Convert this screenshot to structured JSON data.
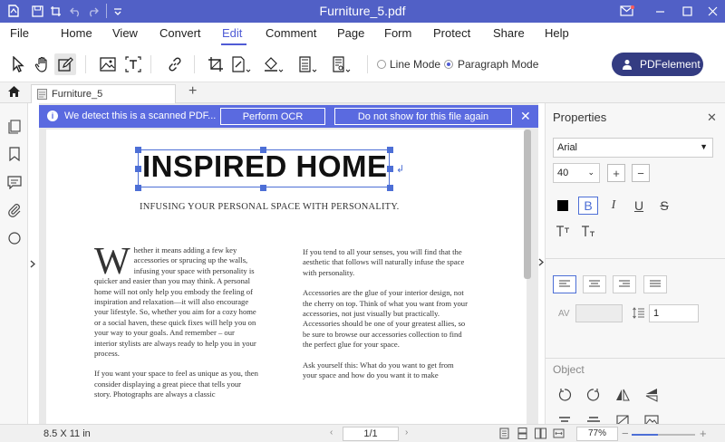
{
  "window": {
    "title": "Furniture_5.pdf",
    "icons": [
      "logo-icon",
      "save-icon",
      "crop-icon",
      "undo-icon",
      "redo-icon",
      "quick-access-icon",
      "mail-icon",
      "minimize-icon",
      "maximize-icon",
      "close-icon"
    ]
  },
  "menu": {
    "items": [
      "File",
      "Home",
      "View",
      "Convert",
      "Edit",
      "Comment",
      "Page",
      "Form",
      "Protect",
      "Share",
      "Help"
    ],
    "active": "Edit"
  },
  "toolbar": {
    "line_mode": "Line Mode",
    "paragraph_mode": "Paragraph Mode",
    "selected_mode": "Paragraph Mode",
    "pdfelement_button": "PDFelement"
  },
  "tabs": {
    "doc_tab": "Furniture_5",
    "add_tab": "+"
  },
  "ocr_bar": {
    "message": "We detect this is a scanned PDF...",
    "perform_ocr": "Perform OCR",
    "do_not_show": "Do not show for this file again",
    "close": "✕"
  },
  "document": {
    "heading": "INSPIRED HOME",
    "subtitle": "INFUSING YOUR PERSONAL SPACE WITH PERSONALITY.",
    "dropcap": "W",
    "col1_p1": "hether it means adding a few key accessories or sprucing up the walls, infusing your space with personality is quicker and easier than you may think. A personal home will not only help you embody the feeling of inspiration and relaxation—it will also encourage your lifestyle. So, whether you aim for a cozy home or a social haven, these quick fixes will help you on your way to your goals. And remember – our interior stylists are always ready to help you in your process.",
    "col1_p2": "If you want your space to feel as unique as you, then consider displaying a great piece that tells your story. Photographs are always a classic",
    "col2_p1": "If you tend to all your senses, you will find that the aesthetic that follows will naturally infuse the space with personality.",
    "col2_p2": "Accessories are the glue of your interior design, not the cherry on top. Think of what you want from your accessories, not just visually but practically. Accessories should be one of your greatest allies, so be sure to browse our accessories collection to find the perfect glue for your space.",
    "col2_p3": "Ask yourself this: What do you want to get from your space and how do you want it to make"
  },
  "properties": {
    "title": "Properties",
    "font": "Arial",
    "size": "40",
    "increase": "+",
    "decrease": "−",
    "bold": "B",
    "italic": "I",
    "underline": "U",
    "strike": "S",
    "char_spacing_label": "AV",
    "line_spacing_value": "1",
    "object_label": "Object",
    "text_color": "#000000",
    "selected_alignment": "left"
  },
  "status": {
    "page_size": "8.5 X 11 in",
    "page_indicator": "1/1",
    "zoom": "77%",
    "zoom_fraction": 0.42
  },
  "colors": {
    "titlebar": "#5160c6",
    "accent": "#4f5bd5",
    "pdfelement_button": "#343c82",
    "ocr_bar": "#5a6ae0"
  }
}
